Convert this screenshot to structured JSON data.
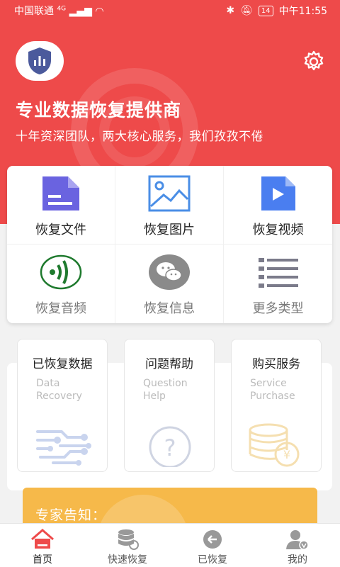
{
  "status_bar": {
    "carrier": "中国联通",
    "network": "4G",
    "battery": "14",
    "time": "中午11:55"
  },
  "header": {
    "title": "专业数据恢复提供商",
    "subtitle": "十年资深团队，两大核心服务，我们孜孜不倦",
    "logo_icon": "shield-chart-icon",
    "settings_icon": "gear-icon"
  },
  "recover_grid": [
    {
      "label": "恢复文件",
      "icon": "file-icon",
      "color": "#6a63e0"
    },
    {
      "label": "恢复图片",
      "icon": "image-icon",
      "color": "#4a8ee6"
    },
    {
      "label": "恢复视频",
      "icon": "video-icon",
      "color": "#4a7ef0"
    },
    {
      "label": "恢复音频",
      "icon": "audio-icon",
      "color": "#1f7a2e"
    },
    {
      "label": "恢复信息",
      "icon": "wechat-icon",
      "color": "#8a8a8a"
    },
    {
      "label": "更多类型",
      "icon": "list-icon",
      "color": "#7b7b8a"
    }
  ],
  "services": [
    {
      "title": "已恢复数据",
      "en1": "Data",
      "en2": "Recovery"
    },
    {
      "title": "问题帮助",
      "en1": "Question",
      "en2": "Help"
    },
    {
      "title": "购买服务",
      "en1": "Service",
      "en2": "Purchase"
    }
  ],
  "expert": {
    "label": "专家告知："
  },
  "nav": [
    {
      "label": "首页",
      "icon": "home-icon"
    },
    {
      "label": "快速恢复",
      "icon": "database-icon"
    },
    {
      "label": "已恢复",
      "icon": "undo-icon"
    },
    {
      "label": "我的",
      "icon": "user-icon"
    }
  ],
  "colors": {
    "brand_red": "#ee4a4a",
    "expert_orange": "#f6b94a"
  }
}
